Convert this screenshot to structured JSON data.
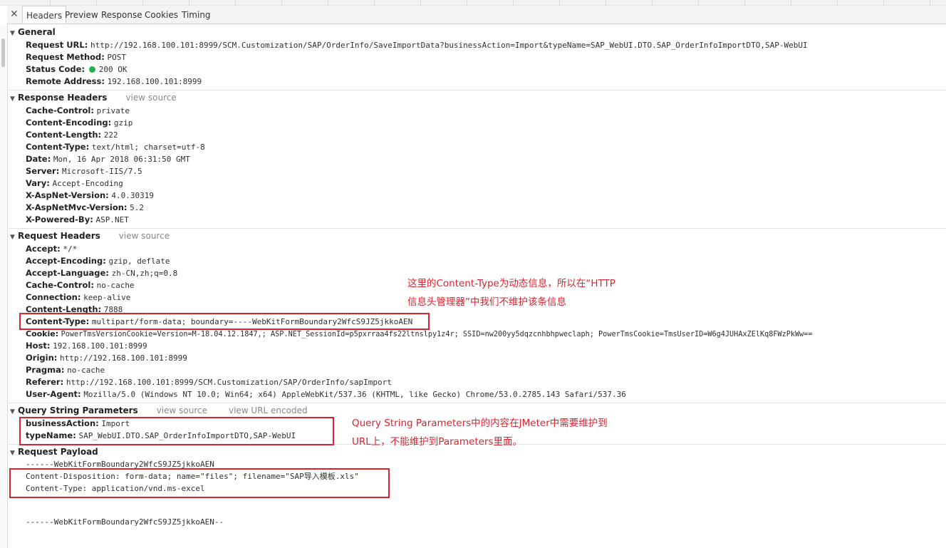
{
  "tabs": [
    "Headers",
    "Preview",
    "Response",
    "Cookies",
    "Timing"
  ],
  "general": {
    "title": "General",
    "rows": [
      {
        "k": "Request URL:",
        "v": "http://192.168.100.101:8999/SCM.Customization/SAP/OrderInfo/SaveImportData?businessAction=Import&typeName=SAP_WebUI.DTO.SAP_OrderInfoImportDTO,SAP-WebUI"
      },
      {
        "k": "Request Method:",
        "v": "POST"
      },
      {
        "k": "Status Code:",
        "v": "200 OK"
      },
      {
        "k": "Remote Address:",
        "v": "192.168.100.101:8999"
      }
    ]
  },
  "response_headers": {
    "title": "Response Headers",
    "view_source": "view source",
    "rows": [
      {
        "k": "Cache-Control:",
        "v": "private"
      },
      {
        "k": "Content-Encoding:",
        "v": "gzip"
      },
      {
        "k": "Content-Length:",
        "v": "222"
      },
      {
        "k": "Content-Type:",
        "v": "text/html; charset=utf-8"
      },
      {
        "k": "Date:",
        "v": "Mon, 16 Apr 2018 06:31:50 GMT"
      },
      {
        "k": "Server:",
        "v": "Microsoft-IIS/7.5"
      },
      {
        "k": "Vary:",
        "v": "Accept-Encoding"
      },
      {
        "k": "X-AspNet-Version:",
        "v": "4.0.30319"
      },
      {
        "k": "X-AspNetMvc-Version:",
        "v": "5.2"
      },
      {
        "k": "X-Powered-By:",
        "v": "ASP.NET"
      }
    ]
  },
  "request_headers": {
    "title": "Request Headers",
    "view_source": "view source",
    "rows": [
      {
        "k": "Accept:",
        "v": "*/*"
      },
      {
        "k": "Accept-Encoding:",
        "v": "gzip, deflate"
      },
      {
        "k": "Accept-Language:",
        "v": "zh-CN,zh;q=0.8"
      },
      {
        "k": "Cache-Control:",
        "v": "no-cache"
      },
      {
        "k": "Connection:",
        "v": "keep-alive"
      },
      {
        "k": "Content-Length:",
        "v": "7888"
      },
      {
        "k": "Content-Type:",
        "v": "multipart/form-data; boundary=----WebKitFormBoundary2WfcS9JZ5jkkoAEN"
      },
      {
        "k": "Cookie:",
        "v": "PowerTmsVersionCookie=Version=M-18.04.12.1847,; ASP.NET_SessionId=p5pxrraa4fs22ltnslpy1z4r; SSID=nw200yy5dqzcnhbhpweclaph; PowerTmsCookie=TmsUserID=W6g4JUHAxZElKq8FWzPkWw=="
      },
      {
        "k": "Host:",
        "v": "192.168.100.101:8999"
      },
      {
        "k": "Origin:",
        "v": "http://192.168.100.101:8999"
      },
      {
        "k": "Pragma:",
        "v": "no-cache"
      },
      {
        "k": "Referer:",
        "v": "http://192.168.100.101:8999/SCM.Customization/SAP/OrderInfo/sapImport"
      },
      {
        "k": "User-Agent:",
        "v": "Mozilla/5.0 (Windows NT 10.0; Win64; x64) AppleWebKit/537.36 (KHTML, like Gecko) Chrome/53.0.2785.143 Safari/537.36"
      }
    ]
  },
  "query_params": {
    "title": "Query String Parameters",
    "view_source": "view source",
    "view_url_encoded": "view URL encoded",
    "rows": [
      {
        "k": "businessAction:",
        "v": "Import"
      },
      {
        "k": "typeName:",
        "v": "SAP_WebUI.DTO.SAP_OrderInfoImportDTO,SAP-WebUI"
      }
    ]
  },
  "payload": {
    "title": "Request Payload",
    "lines": [
      "------WebKitFormBoundary2WfcS9JZ5jkkoAEN",
      "Content-Disposition: form-data; name=\"files\"; filename=\"SAP导入模板.xls\"",
      "Content-Type: application/vnd.ms-excel",
      "------WebKitFormBoundary2WfcS9JZ5jkkoAEN--"
    ]
  },
  "annotations": {
    "note1_line1": "这里的Content-Type为动态信息，所以在“HTTP",
    "note1_line2": "信息头管理器”中我们不维护该条信息",
    "note2_line1": "Query String Parameters中的内容在JMeter中需要维护到",
    "note2_line2": "URL上，不能维护到Parameters里面。"
  },
  "colors": {
    "status_ok": "#1fb24b",
    "annotation_red": "#d9232e"
  }
}
